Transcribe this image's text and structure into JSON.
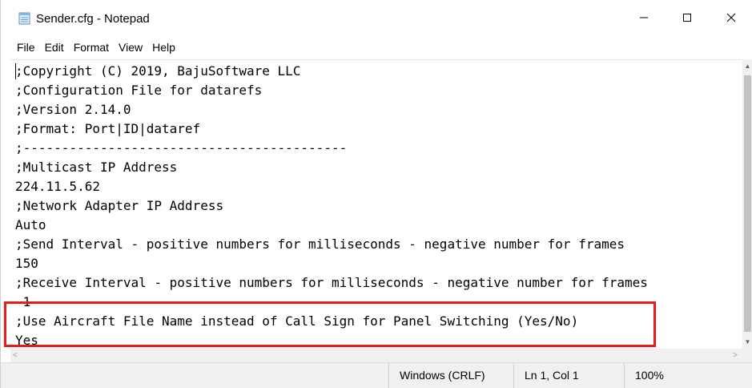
{
  "window": {
    "title": "Sender.cfg - Notepad",
    "icons": {
      "app": "notepad-icon",
      "minimize": "minimize-icon",
      "maximize": "maximize-icon",
      "close": "close-icon"
    }
  },
  "menu": [
    "File",
    "Edit",
    "Format",
    "View",
    "Help"
  ],
  "editor": {
    "lines": [
      ";Copyright (C) 2019, BajuSoftware LLC",
      ";Configuration File for datarefs",
      ";Version 2.14.0",
      ";Format: Port|ID|dataref",
      ";------------------------------------------",
      ";Multicast IP Address",
      "224.11.5.62",
      ";Network Adapter IP Address",
      "Auto",
      ";Send Interval - positive numbers for milliseconds - negative number for frames",
      "150",
      ";Receive Interval - positive numbers for milliseconds - negative number for frames",
      "-1",
      ";Use Aircraft File Name instead of Call Sign for Panel Switching (Yes/No)",
      "Yes"
    ]
  },
  "scrollbars": {
    "left_arrow": "<",
    "right_arrow": ">",
    "up_arrow": "▲",
    "down_arrow": "▼"
  },
  "status": {
    "line_ending": "Windows (CRLF)",
    "position": "Ln 1, Col 1",
    "zoom": "100%"
  },
  "annotation": {
    "highlight_color": "#e81a1a"
  }
}
